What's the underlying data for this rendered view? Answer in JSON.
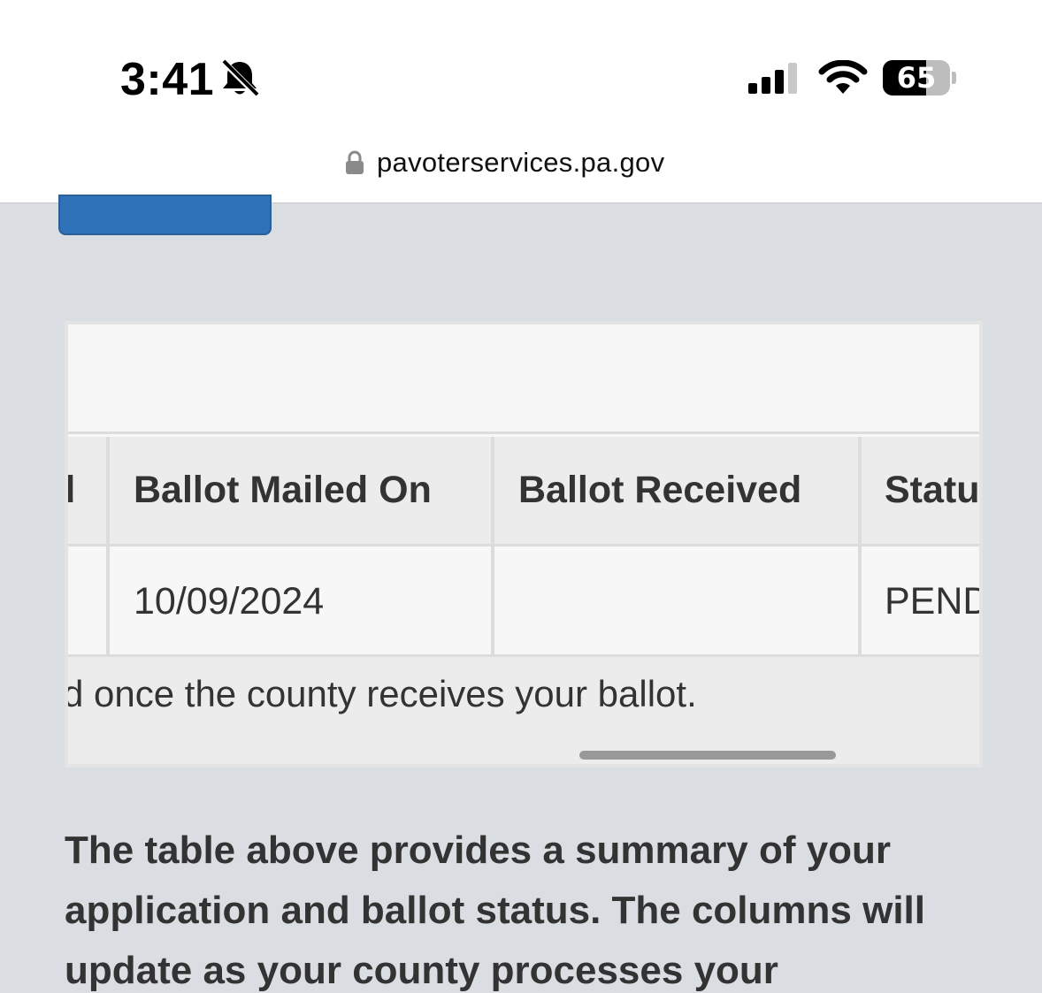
{
  "status_bar": {
    "time": "3:41",
    "battery_level": "65",
    "battery_fraction": 0.65,
    "signal_bars": 3,
    "icons": [
      "bell-slash-icon",
      "cellular-signal-icon",
      "wifi-icon",
      "battery-icon"
    ]
  },
  "browser": {
    "url": "pavoterservices.pa.gov"
  },
  "table": {
    "partial_first_header": "d",
    "headers": [
      "Ballot Mailed On",
      "Ballot Received",
      "Statu"
    ],
    "row": [
      "10/09/2024",
      "",
      "PEND"
    ],
    "note": "d once the county receives your ballot."
  },
  "summary": {
    "text": "The table above provides a summary of your application and ballot status. The columns will update as your county processes your"
  },
  "colors": {
    "page_background": "#dadee3",
    "button_blue": "#2f72b8",
    "header_cell": "#ececec",
    "body_cell": "#f7f7f7",
    "text": "#333333"
  }
}
